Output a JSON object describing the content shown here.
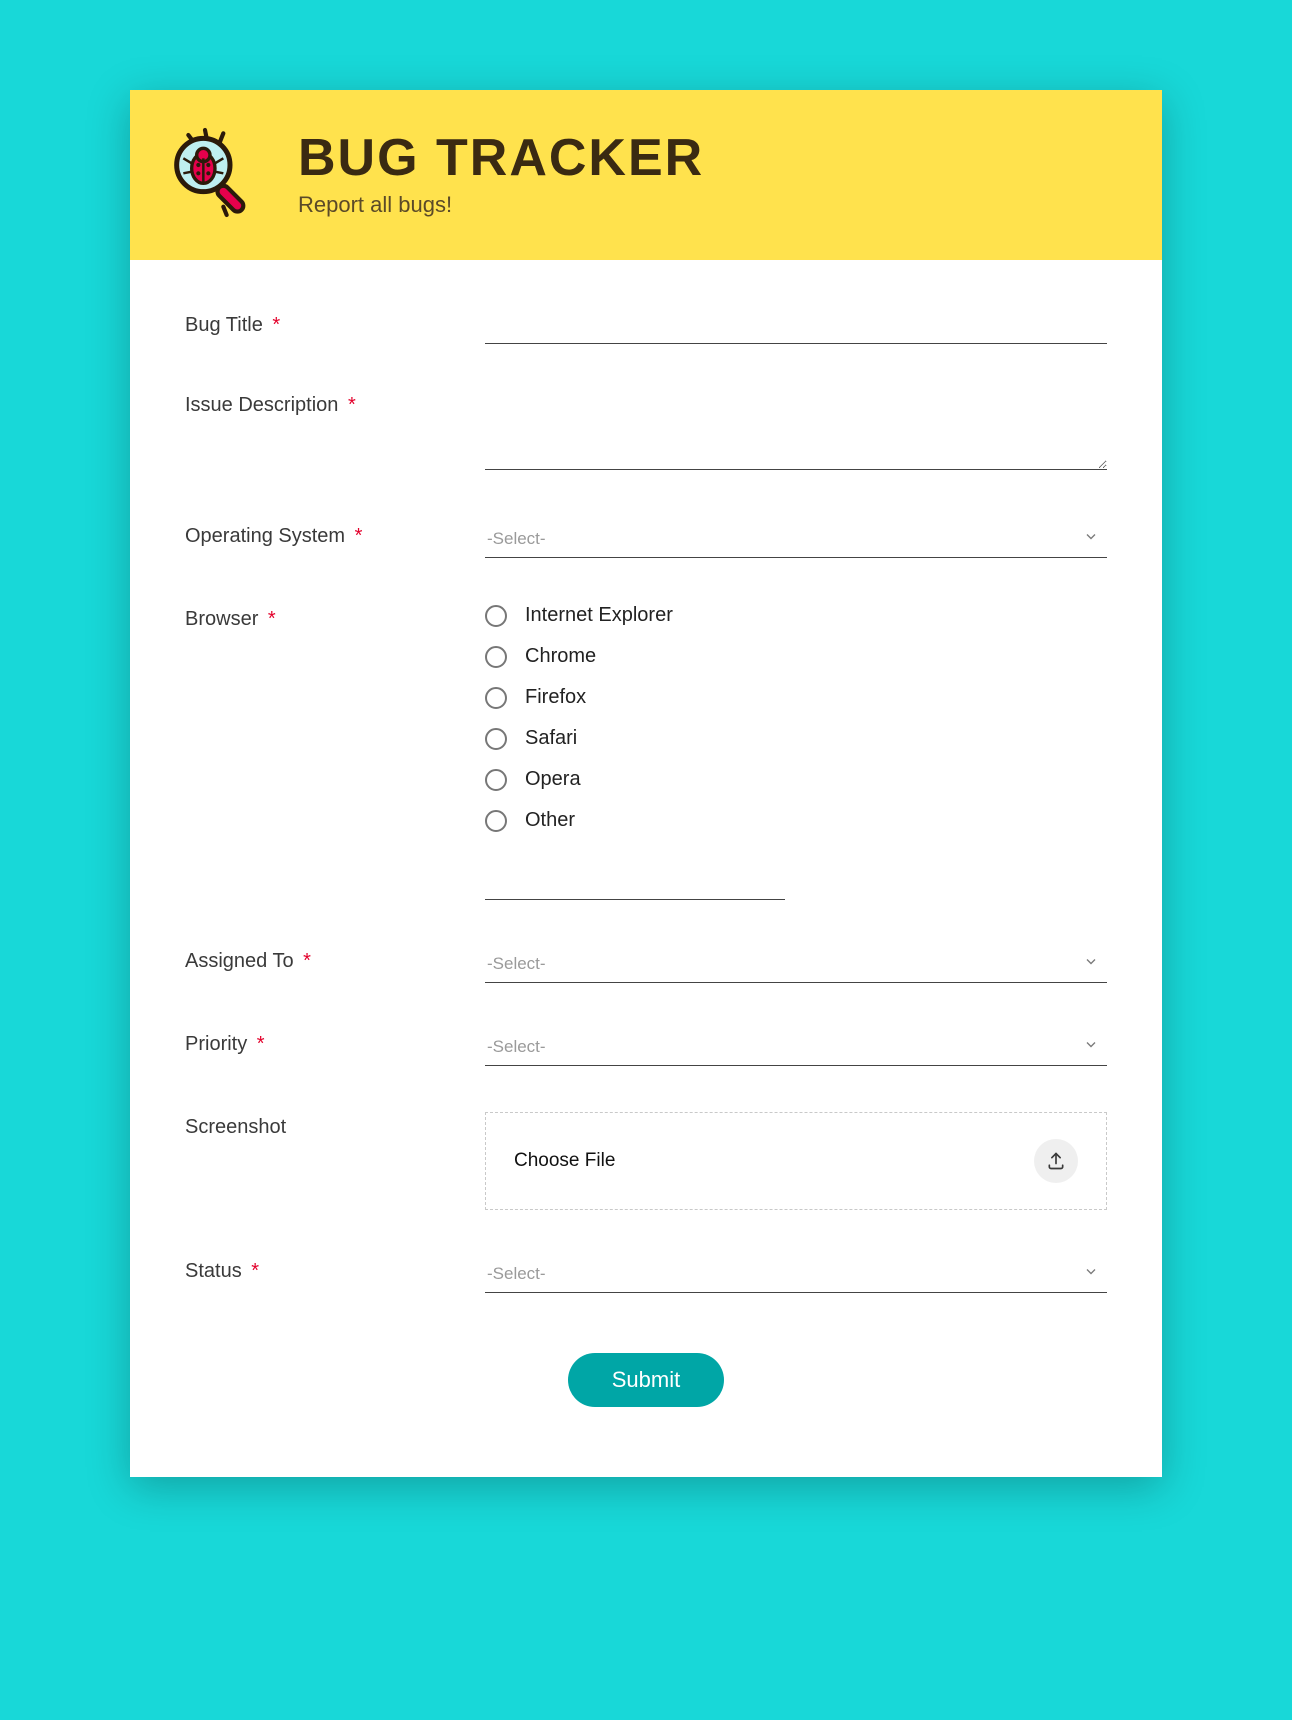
{
  "header": {
    "title": "BUG TRACKER",
    "subtitle": "Report all bugs!"
  },
  "fields": {
    "bug_title": {
      "label": "Bug Title",
      "required": true,
      "value": ""
    },
    "issue_description": {
      "label": "Issue Description",
      "required": true,
      "value": ""
    },
    "operating_system": {
      "label": "Operating System",
      "required": true,
      "placeholder": "-Select-"
    },
    "browser": {
      "label": "Browser",
      "required": true,
      "options": [
        "Internet Explorer",
        "Chrome",
        "Firefox",
        "Safari",
        "Opera",
        "Other"
      ],
      "other_value": ""
    },
    "assigned_to": {
      "label": "Assigned To",
      "required": true,
      "placeholder": "-Select-"
    },
    "priority": {
      "label": "Priority",
      "required": true,
      "placeholder": "-Select-"
    },
    "screenshot": {
      "label": "Screenshot",
      "required": false,
      "button": "Choose File"
    },
    "status": {
      "label": "Status",
      "required": true,
      "placeholder": "-Select-"
    }
  },
  "submit": {
    "label": "Submit"
  },
  "required_marker": "*"
}
